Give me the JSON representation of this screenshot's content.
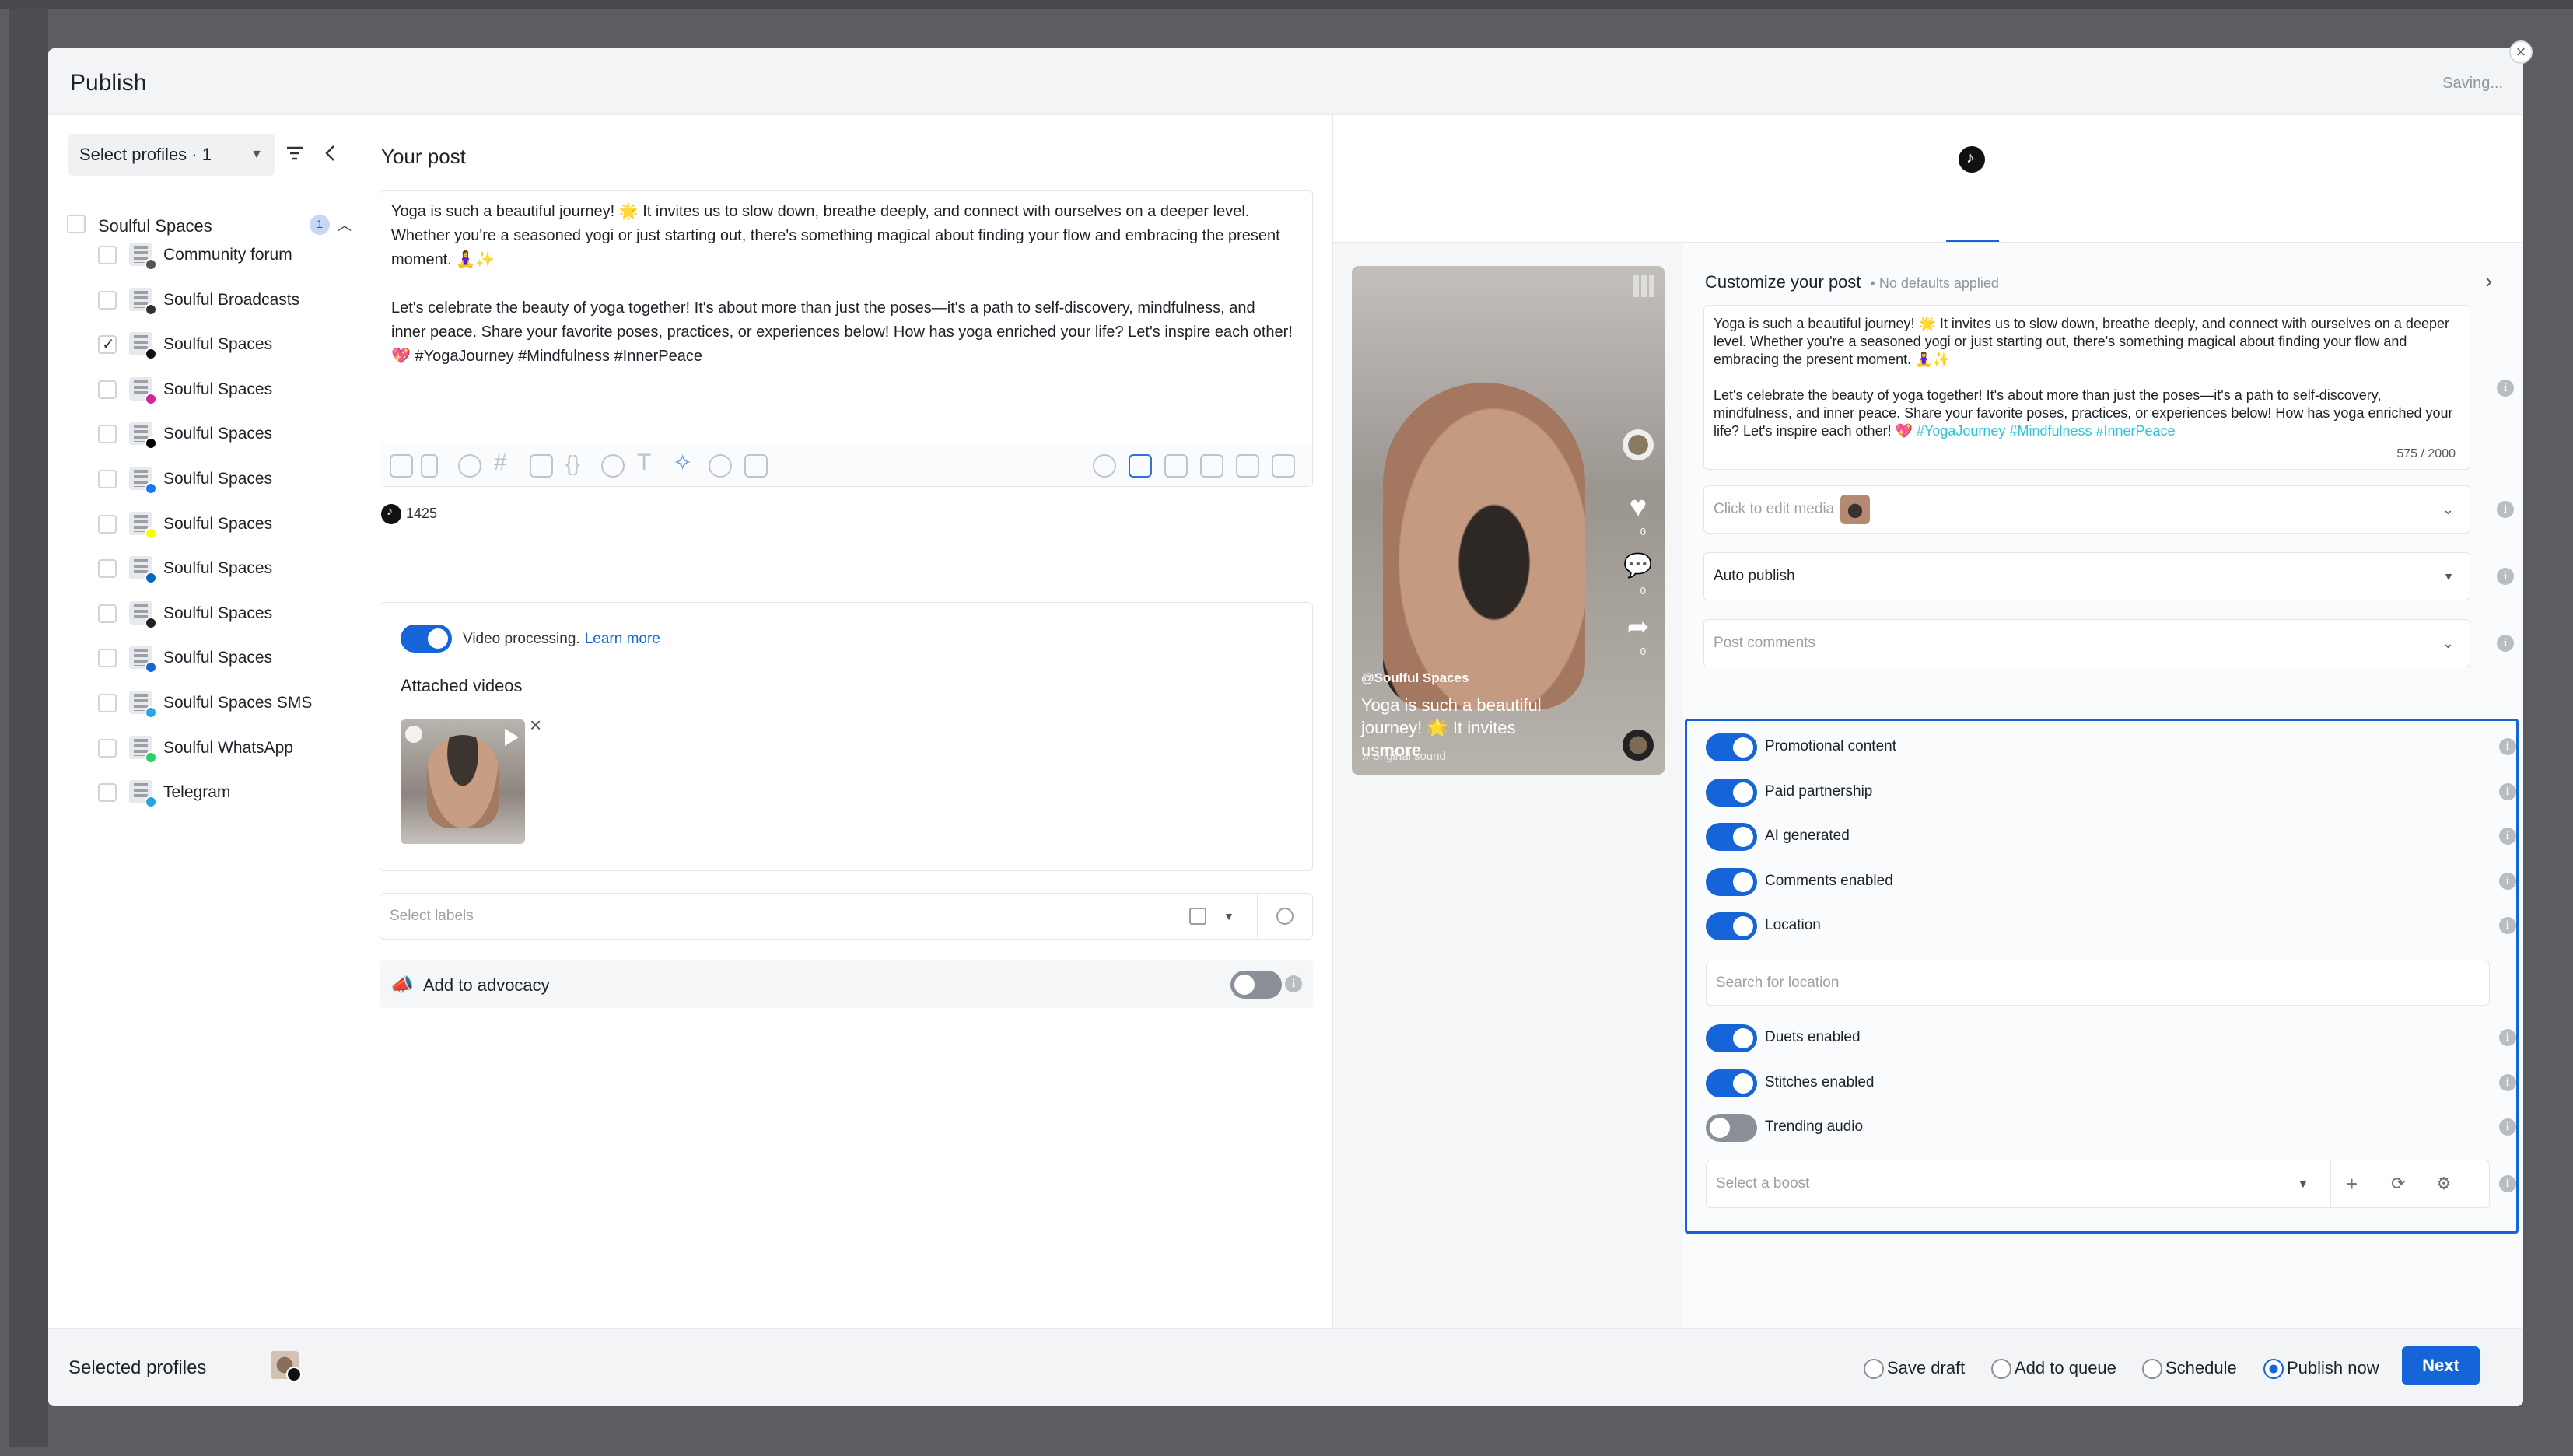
{
  "modal": {
    "title": "Publish",
    "status": "Saving...",
    "close": "×"
  },
  "profiles": {
    "select_label": "Select profiles · 1",
    "group": {
      "name": "Soulful Spaces",
      "count": "1"
    },
    "items": [
      {
        "label": "Community forum",
        "checked": false,
        "badge_color": "#555555"
      },
      {
        "label": "Soulful Broadcasts",
        "checked": false,
        "badge_color": "#333333"
      },
      {
        "label": "Soulful Spaces",
        "checked": true,
        "badge_color": "#111111"
      },
      {
        "label": "Soulful Spaces",
        "checked": false,
        "badge_color": "#d6249f"
      },
      {
        "label": "Soulful Spaces",
        "checked": false,
        "badge_color": "#000000"
      },
      {
        "label": "Soulful Spaces",
        "checked": false,
        "badge_color": "#1877f2"
      },
      {
        "label": "Soulful Spaces",
        "checked": false,
        "badge_color": "#fffc00"
      },
      {
        "label": "Soulful Spaces",
        "checked": false,
        "badge_color": "#0a66c2"
      },
      {
        "label": "Soulful Spaces",
        "checked": false,
        "badge_color": "#222222"
      },
      {
        "label": "Soulful Spaces",
        "checked": false,
        "badge_color": "#1565d8"
      },
      {
        "label": "Soulful Spaces SMS",
        "checked": false,
        "badge_color": "#27a7e7"
      },
      {
        "label": "Soulful WhatsApp",
        "checked": false,
        "badge_color": "#25d366"
      },
      {
        "label": "Telegram",
        "checked": false,
        "badge_color": "#2aa3e0"
      }
    ]
  },
  "post": {
    "heading": "Your post",
    "para1": "Yoga is such a beautiful journey! 🌟 It invites us to slow down, breathe deeply, and connect with ourselves on a deeper level. Whether you're a seasoned yogi or just starting out, there's something magical about finding your flow and embracing the present moment. 🧘‍♀️✨",
    "para2": "Let's celebrate the beauty of yoga together! It's about more than just the poses—it's a path to self-discovery, mindfulness, and inner peace. Share your favorite poses, practices, or experiences below! How has yoga enriched your life? Let's inspire each other! 💖 #YogaJourney #Mindfulness #InnerPeace",
    "grammar_count": "1",
    "char_count": "1425",
    "video_processing": "Video processing.",
    "learn_more": "Learn more",
    "attached_videos": "Attached videos",
    "labels_placeholder": "Select labels",
    "advocacy": "Add to advocacy"
  },
  "preview": {
    "handle": "@Soulful Spaces",
    "caption": "Yoga is such a beautiful journey! 🌟 It invites us",
    "more": "more",
    "sound": "original sound",
    "likes": "0",
    "comments": "0",
    "shares": "0"
  },
  "customize": {
    "title": "Customize your post",
    "defaults": "• No defaults applied",
    "text1": "Yoga is such a beautiful journey! 🌟 It invites us to slow down, breathe deeply, and connect with ourselves on a deeper level. Whether you're a seasoned yogi or just starting out, there's something magical about finding your flow and embracing the present moment. 🧘‍♀️✨",
    "text2": "Let's celebrate the beauty of yoga together! It's about more than just the poses—it's a path to self-discovery, mindfulness, and inner peace. Share your favorite poses, practices, or experiences below! How has yoga enriched your life? Let's inspire each other! 💖",
    "hashtags": "#YogaJourney #Mindfulness #InnerPeace",
    "counter": "575 / 2000",
    "media": "Click to edit media",
    "publish_mode": "Auto publish",
    "post_comments": "Post comments",
    "toggles": [
      {
        "label": "Promotional content",
        "on": true
      },
      {
        "label": "Paid partnership",
        "on": true
      },
      {
        "label": "AI generated",
        "on": true
      },
      {
        "label": "Comments enabled",
        "on": true
      },
      {
        "label": "Location",
        "on": true
      }
    ],
    "location_placeholder": "Search for location",
    "toggles2": [
      {
        "label": "Duets enabled",
        "on": true
      },
      {
        "label": "Stitches enabled",
        "on": true
      },
      {
        "label": "Trending audio",
        "on": false
      }
    ],
    "boost_placeholder": "Select a boost"
  },
  "footer": {
    "selected_profiles": "Selected profiles",
    "options": [
      "Save draft",
      "Add to queue",
      "Schedule",
      "Publish now"
    ],
    "selected_option": "Publish now",
    "next": "Next"
  },
  "colors": {
    "accent": "#1565d8",
    "hashtag": "#29c5d6"
  }
}
